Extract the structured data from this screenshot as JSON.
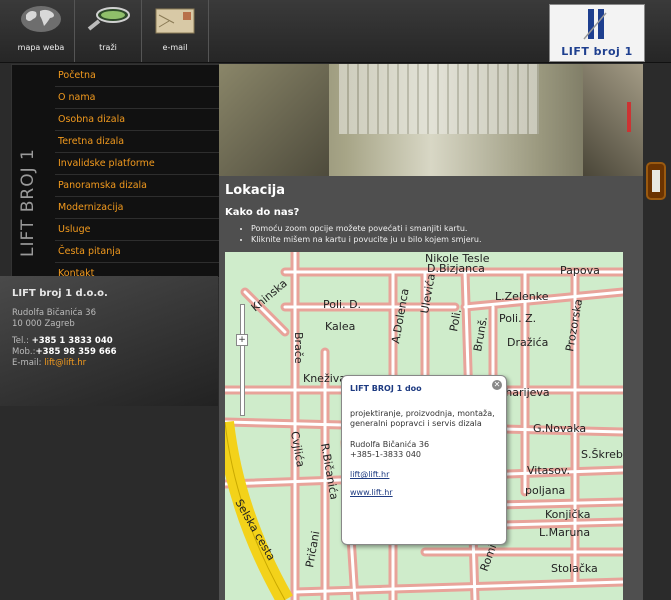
{
  "topnav": [
    {
      "label": "mapa weba",
      "icon": "world-map-icon"
    },
    {
      "label": "traži",
      "icon": "magnifier-icon"
    },
    {
      "label": "e-mail",
      "icon": "envelope-icon"
    }
  ],
  "logo": {
    "text": "LIFT broj 1"
  },
  "sidebar": {
    "vertical_title": "LIFT BROJ 1",
    "menu": [
      "Početna",
      "O nama",
      "Osobna dizala",
      "Teretna dizala",
      "Invalidske platforme",
      "Panoramska dizala",
      "Modernizacija",
      "Usluge",
      "Česta pitanja",
      "Kontakt"
    ]
  },
  "company": {
    "name": "LIFT broj 1 d.o.o.",
    "street": "Rudolfa Bičanića 36",
    "city": "10 000 Zagreb",
    "tel_label": "Tel.:",
    "tel": "+385 1 3833 040",
    "mob_label": "Mob.:",
    "mob": "+385 98 359 666",
    "email_label": "E-mail:",
    "email": "lift@lift.hr"
  },
  "content": {
    "title": "Lokacija",
    "subtitle": "Kako do nas?",
    "bullets": [
      "Pomoću zoom opcije možete povećati i smanjiti kartu.",
      "Kliknite mišem na kartu i povucite ju u bilo kojem smjeru."
    ]
  },
  "map": {
    "streets": [
      "Nikole Tesle",
      "D.Bizjanca",
      "Papova",
      "Kninska",
      "Poli. D.",
      "Kalea",
      "A.Dolenca",
      "Ulevića",
      "L.Zelenke",
      "Poli. Z.",
      "Dražića",
      "Prozorska",
      "Poli.",
      "Brunš.",
      "Brače",
      "Kneživa",
      "Zaharijeva",
      "G.Novaka",
      "S.Škrebl",
      "Cvjlića",
      "R.Bičanića",
      "Vitasov.",
      "poljana",
      "Konjička",
      "L.Maruna",
      "Selska cesta",
      "Pričani",
      "Romića",
      "Stolačka"
    ],
    "popup": {
      "title": "LIFT BROJ 1 doo",
      "desc": "projektiranje, proizvodnja, montaža, generalni popravci i servis dizala",
      "address": "Rudolfa Bičanića 36",
      "phone": "+385-1-3833 040",
      "email": "lift@lift.hr",
      "web": "www.lift.hr"
    }
  }
}
